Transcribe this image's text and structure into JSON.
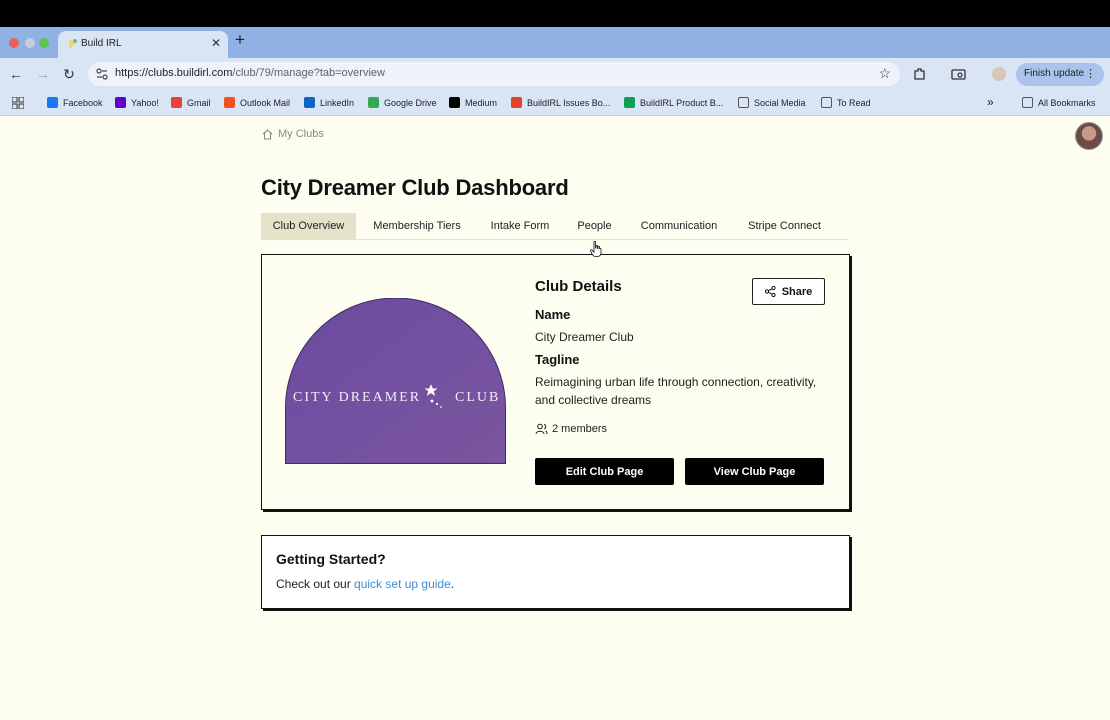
{
  "browser": {
    "tab_title": "Build IRL",
    "url_host": "https://clubs.buildirl.com",
    "url_path": "/club/79/manage?tab=overview",
    "finish_update_label": "Finish update"
  },
  "bookmarks": [
    {
      "label": "Facebook",
      "icon": "facebook-icon",
      "color": "#1877f2"
    },
    {
      "label": "Yahoo!",
      "icon": "yahoo-icon",
      "color": "#6001d2"
    },
    {
      "label": "Gmail",
      "icon": "gmail-icon",
      "color": "#ea4335"
    },
    {
      "label": "Outlook Mail",
      "icon": "outlook-icon",
      "color": "#f25022"
    },
    {
      "label": "LinkedIn",
      "icon": "linkedin-icon",
      "color": "#0a66c2"
    },
    {
      "label": "Google Drive",
      "icon": "drive-icon",
      "color": "#34a853"
    },
    {
      "label": "Medium",
      "icon": "medium-icon",
      "color": "#000000"
    },
    {
      "label": "BuildIRL Issues Bo...",
      "icon": "gitlab-icon",
      "color": "#e24329"
    },
    {
      "label": "BuildIRL Product B...",
      "icon": "sheets-icon",
      "color": "#0f9d58"
    },
    {
      "label": "Social Media",
      "icon": "folder-icon",
      "color": "#555555"
    },
    {
      "label": "To Read",
      "icon": "folder-icon",
      "color": "#555555"
    }
  ],
  "all_bookmarks_label": "All Bookmarks",
  "breadcrumb": {
    "label": "My Clubs"
  },
  "page_title": "City Dreamer Club Dashboard",
  "tabs": [
    {
      "label": "Club Overview",
      "active": true
    },
    {
      "label": "Membership Tiers",
      "active": false
    },
    {
      "label": "Intake Form",
      "active": false
    },
    {
      "label": "People",
      "active": false
    },
    {
      "label": "Communication",
      "active": false
    },
    {
      "label": "Stripe Connect",
      "active": false
    }
  ],
  "club": {
    "logo_text_left": "CITY DREAMER",
    "logo_text_right": "CLUB",
    "details_heading": "Club Details",
    "share_label": "Share",
    "name_label": "Name",
    "name_value": "City Dreamer Club",
    "tagline_label": "Tagline",
    "tagline_value": "Reimagining urban life through connection, creativity, and collective dreams",
    "members": "2 members",
    "edit_label": "Edit Club Page",
    "view_label": "View Club Page"
  },
  "getting_started": {
    "heading": "Getting Started?",
    "text_before": "Check out our ",
    "link_text": "quick set up guide",
    "text_after": "."
  },
  "colors": {
    "page_bg": "#fdfdf0",
    "active_tab_bg": "#e4e2c9",
    "logo_purple": "#6a4a9c",
    "link": "#3f8bd6"
  }
}
